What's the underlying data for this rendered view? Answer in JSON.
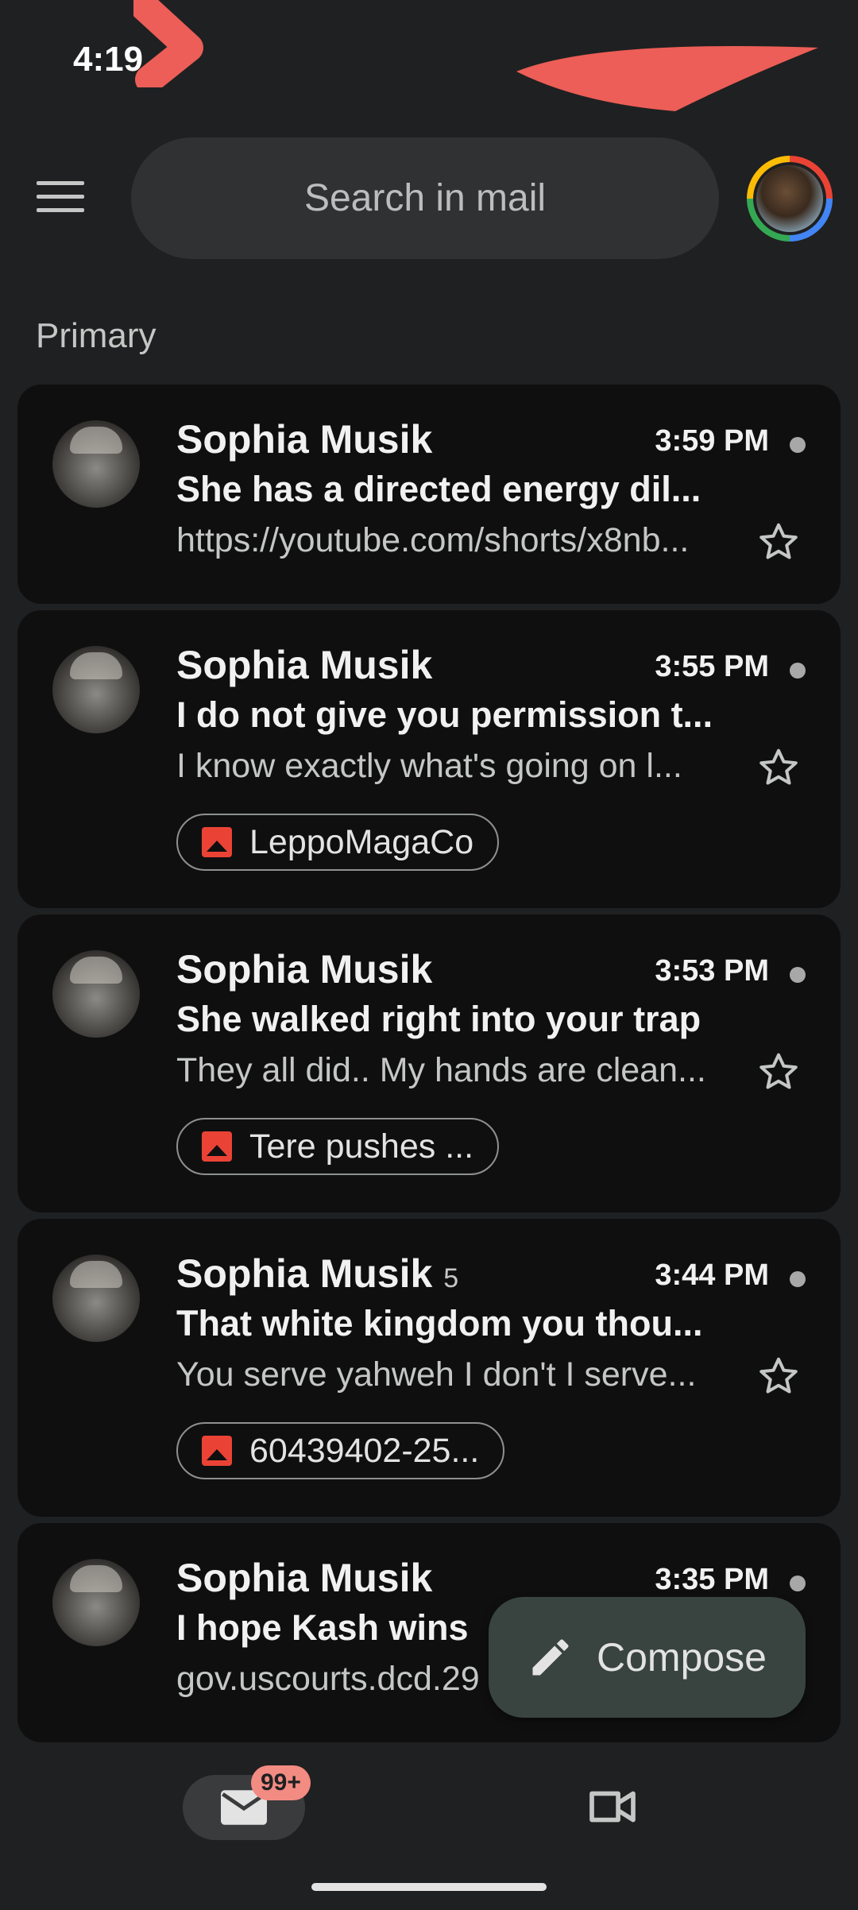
{
  "status_bar": {
    "time": "4:19"
  },
  "top_bar": {
    "search_placeholder": "Search in mail"
  },
  "section": {
    "label": "Primary"
  },
  "emails": [
    {
      "sender": "Sophia Musik",
      "count": "",
      "time": "3:59 PM",
      "subject": "She has a directed energy dil...",
      "snippet": "https://youtube.com/shorts/x8nb...",
      "attachment": ""
    },
    {
      "sender": "Sophia Musik",
      "count": "",
      "time": "3:55 PM",
      "subject": "I do not give you permission t...",
      "snippet": "I know exactly what's going on l...",
      "attachment": "LeppoMagaCo"
    },
    {
      "sender": "Sophia Musik",
      "count": "",
      "time": "3:53 PM",
      "subject": "She walked right into your trap",
      "snippet": "They all did.. My hands are clean...",
      "attachment": "Tere pushes ..."
    },
    {
      "sender": "Sophia Musik",
      "count": "5",
      "time": "3:44 PM",
      "subject": "That white kingdom you thou...",
      "snippet": "You serve yahweh I don't I serve...",
      "attachment": "60439402-25..."
    },
    {
      "sender": "Sophia Musik",
      "count": "",
      "time": "3:35 PM",
      "subject": "I hope Kash wins",
      "snippet": "gov.uscourts.dcd.29",
      "attachment": ""
    }
  ],
  "compose": {
    "label": "Compose"
  },
  "bottom_nav": {
    "mail_badge": "99+"
  },
  "icons": {
    "menu": "menu-icon",
    "star": "star-outline-icon",
    "image": "image-attachment-icon",
    "compose": "pencil-icon",
    "mail": "mail-icon",
    "meet": "video-camera-icon"
  },
  "colors": {
    "background": "#1f2021",
    "card": "#0f0f10",
    "badge": "#f28b82",
    "fab": "#394440"
  }
}
